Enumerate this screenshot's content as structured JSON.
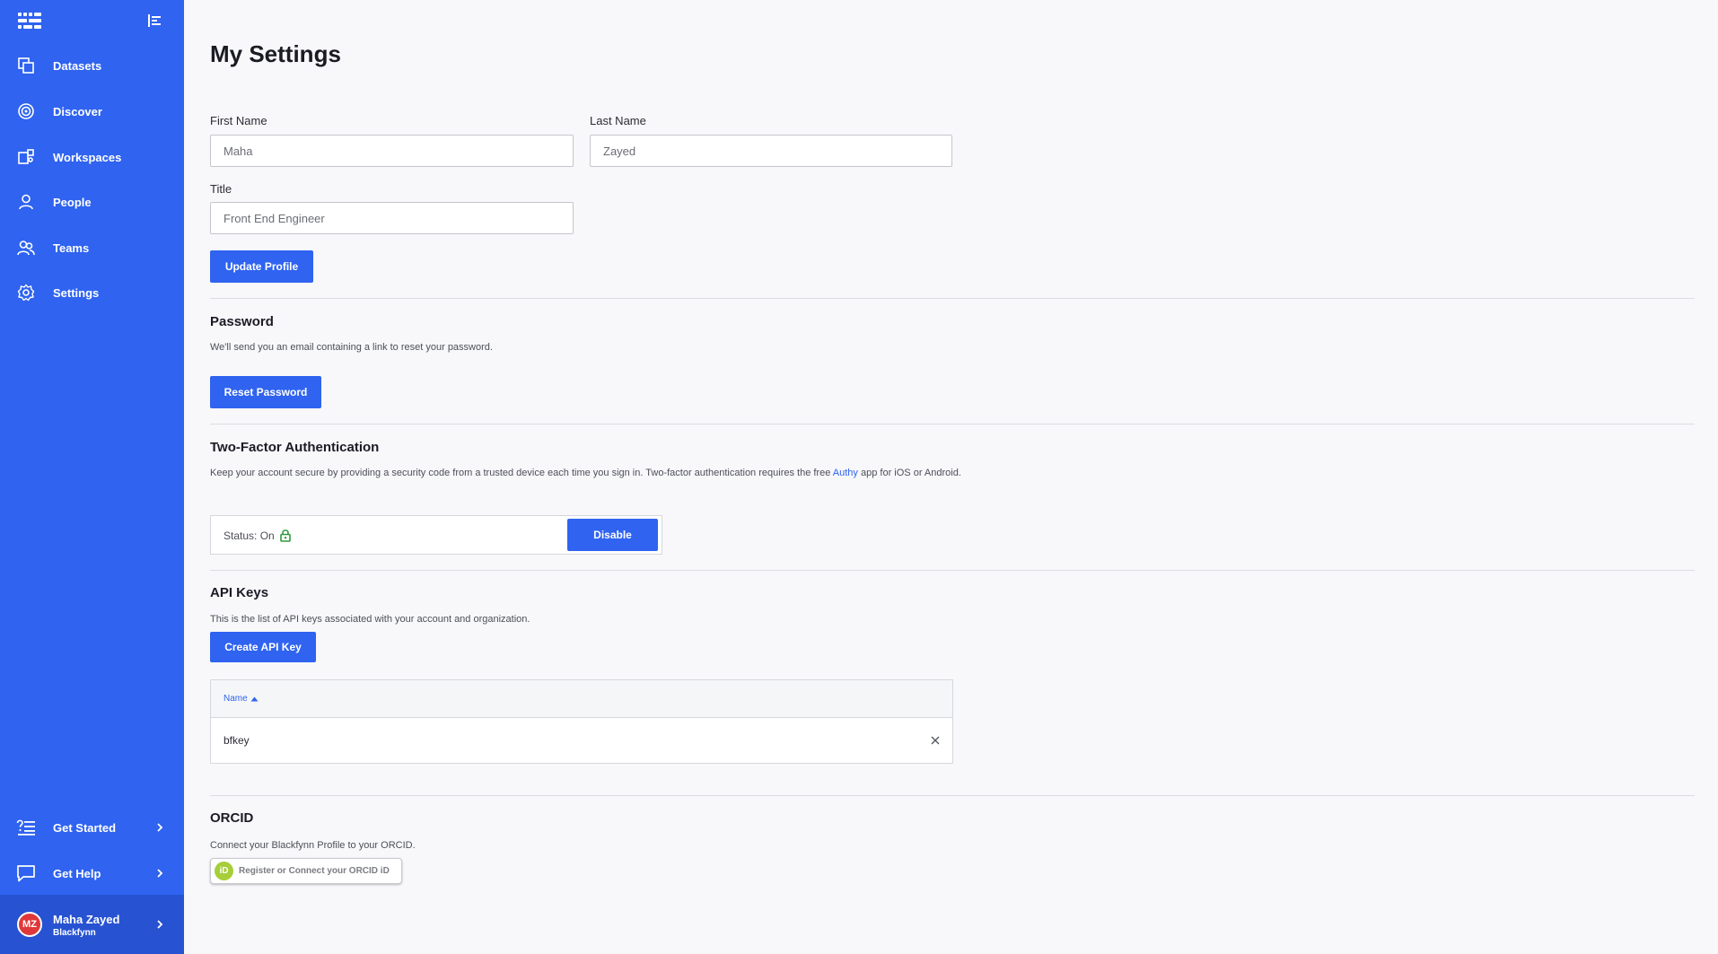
{
  "sidebar": {
    "items": [
      {
        "label": "Datasets",
        "icon": "datasets-icon"
      },
      {
        "label": "Discover",
        "icon": "discover-icon"
      },
      {
        "label": "Workspaces",
        "icon": "workspaces-icon"
      },
      {
        "label": "People",
        "icon": "person-icon"
      },
      {
        "label": "Teams",
        "icon": "teams-icon"
      },
      {
        "label": "Settings",
        "icon": "gear-icon"
      }
    ],
    "bottom_items": [
      {
        "label": "Get Started",
        "icon": "get-started-icon"
      },
      {
        "label": "Get Help",
        "icon": "chat-icon"
      }
    ],
    "user": {
      "initials": "MZ",
      "name": "Maha Zayed",
      "org": "Blackfynn"
    }
  },
  "main": {
    "title": "My Settings",
    "profile": {
      "first_name_label": "First Name",
      "first_name_value": "Maha",
      "last_name_label": "Last Name",
      "last_name_value": "Zayed",
      "title_label": "Title",
      "title_value": "Front End Engineer",
      "update_button": "Update Profile"
    },
    "password": {
      "title": "Password",
      "description": "We'll send you an email containing a link to reset your password.",
      "reset_button": "Reset Password"
    },
    "two_factor": {
      "title": "Two-Factor Authentication",
      "description_1": "Keep your account secure by providing a security code from a trusted device each time you sign in. Two-factor authentication requires the free",
      "link": "Authy",
      "description_2": "app for iOS or Android.",
      "status": "Status: On",
      "disable_button": "Disable"
    },
    "api_keys": {
      "title": "API Keys",
      "description": "This is the list of API keys associated with your account and organization.",
      "create_button": "Create API Key",
      "column_name": "Name",
      "rows": [
        {
          "name": "bfkey"
        }
      ]
    },
    "orcid": {
      "title": "ORCID",
      "description": "Connect your Blackfynn Profile to your ORCID.",
      "logo_text": "iD",
      "button": "Register or Connect your ORCID iD"
    }
  },
  "colors": {
    "primary": "#2f63f0",
    "sidebar_user_bg": "#2753d2",
    "orcid_green": "#a6ce39",
    "lock_green": "#2e9a3c"
  }
}
